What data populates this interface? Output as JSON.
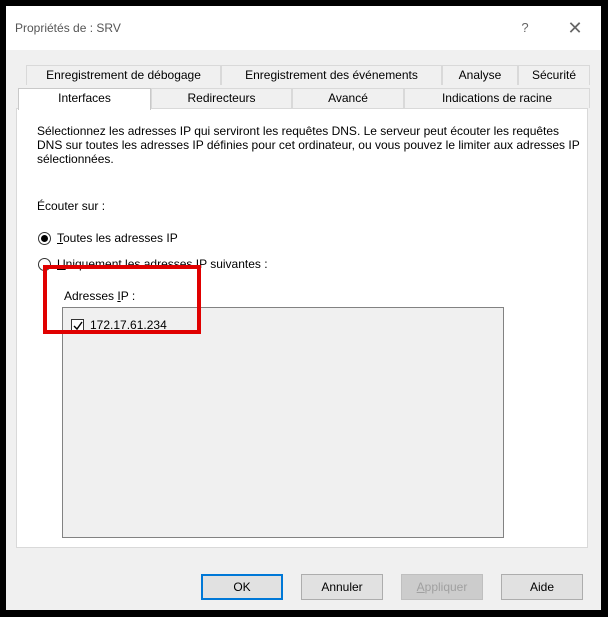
{
  "window": {
    "title": "Propriétés de : SRV",
    "help_symbol": "?",
    "close_symbol": "✕"
  },
  "tabs": {
    "row1": [
      "Enregistrement de débogage",
      "Enregistrement des événements",
      "Analyse",
      "Sécurité"
    ],
    "row2": [
      "Interfaces",
      "Redirecteurs",
      "Avancé",
      "Indications de racine"
    ],
    "active": "Interfaces"
  },
  "interfaces": {
    "description": "Sélectionnez les adresses IP qui serviront les requêtes DNS. Le serveur peut écouter les requêtes DNS sur toutes les adresses IP définies pour cet ordinateur, ou vous pouvez le limiter aux adresses IP sélectionnées.",
    "listen_on_label": "Écouter sur :",
    "radio_all_prefix": "",
    "radio_all_mnemonic": "T",
    "radio_all_rest": "outes les adresses IP",
    "radio_specific_prefix": "",
    "radio_specific_mnemonic": "U",
    "radio_specific_rest": "niquement les adresses IP suivantes :",
    "selected_option": "all",
    "ip_addresses_label_prefix": "Adresses ",
    "ip_addresses_label_mnemonic": "I",
    "ip_addresses_label_rest": "P :",
    "ip_list": [
      {
        "address": "172.17.61.234",
        "checked": true
      }
    ]
  },
  "buttons": {
    "ok": "OK",
    "cancel": "Annuler",
    "apply": "Appliquer",
    "help": "Aide"
  },
  "colors": {
    "highlight": "#e00000",
    "dialog_bg": "#f0f0f0",
    "default_button_border": "#0078d7"
  }
}
